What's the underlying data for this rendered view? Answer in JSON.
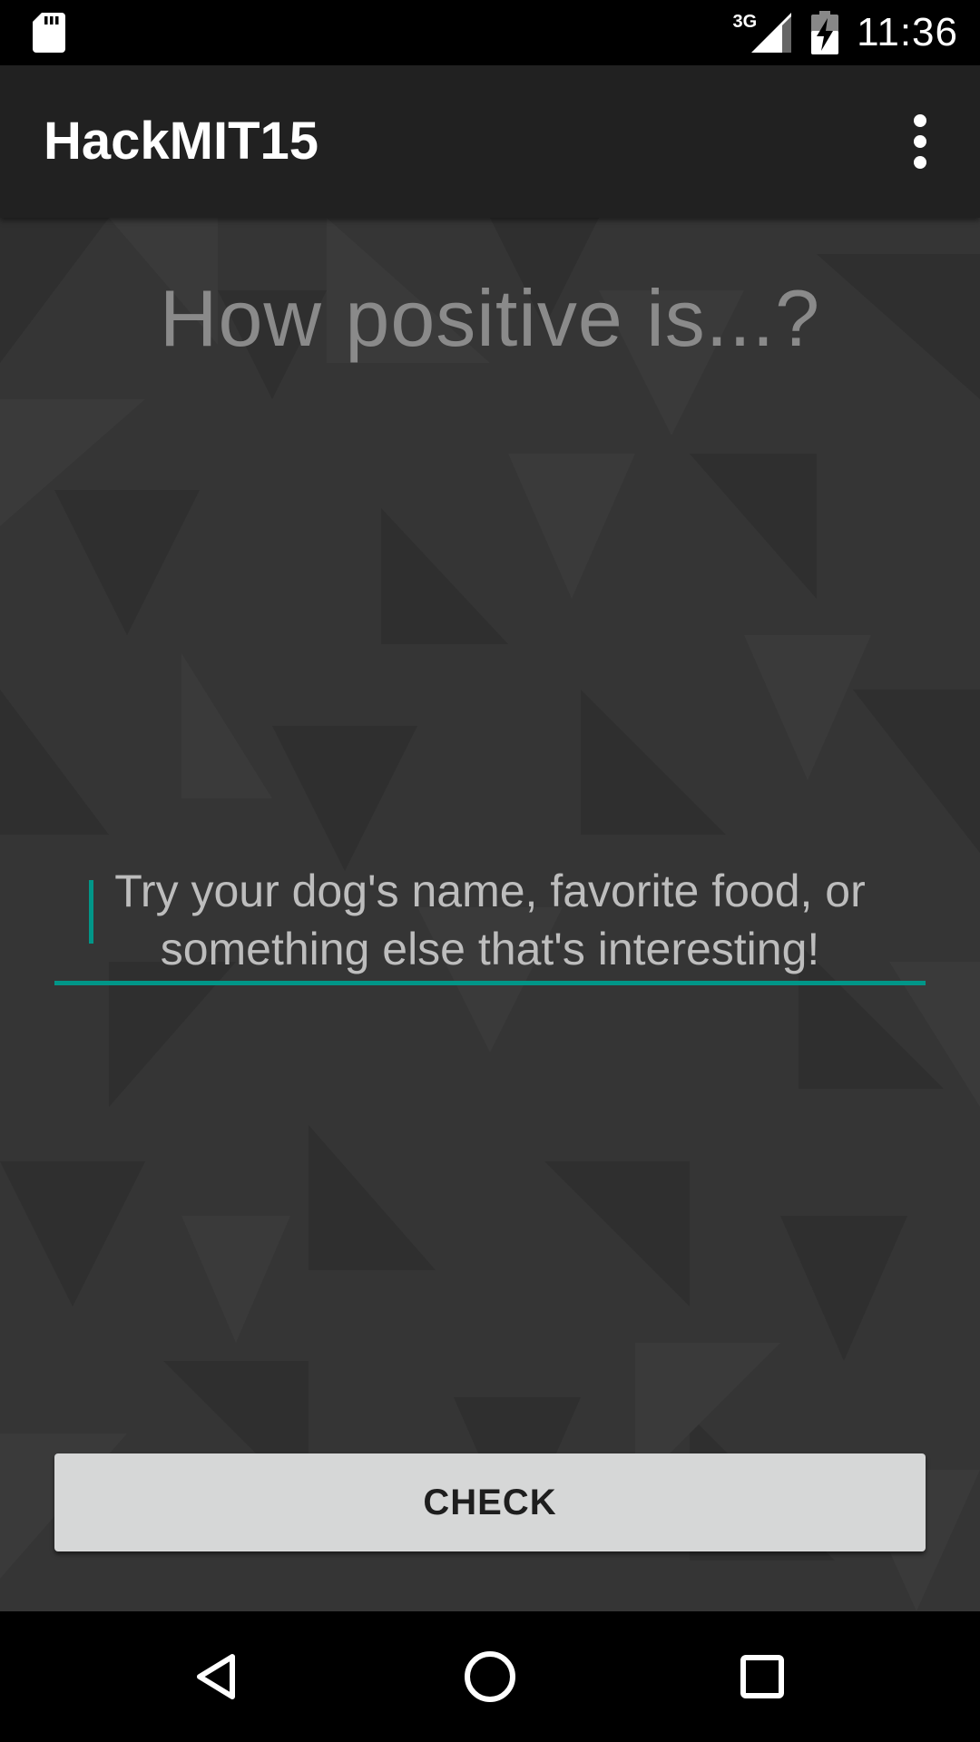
{
  "status_bar": {
    "network": "3G",
    "time": "11:36",
    "icons": [
      "sd-card-icon",
      "signal-icon",
      "battery-charging-icon"
    ]
  },
  "app_bar": {
    "title": "HackMIT15",
    "menu_icon": "overflow-menu-icon"
  },
  "main": {
    "headline": "How positive is...?",
    "input": {
      "value": "",
      "placeholder": "Try your dog's name, favorite food, or something else that's interesting!"
    },
    "check_button_label": "CHECK"
  },
  "nav_bar": {
    "icons": [
      "back-icon",
      "home-icon",
      "recents-icon"
    ]
  },
  "colors": {
    "accent": "#009688",
    "app_bar": "#212121",
    "background": "#353535",
    "button": "#d6d7d7"
  }
}
